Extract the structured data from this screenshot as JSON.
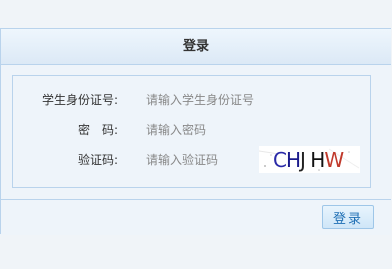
{
  "panel": {
    "title": "登录"
  },
  "form": {
    "student_id": {
      "label": "学生身份证号:",
      "placeholder": "请输入学生身份证号",
      "value": ""
    },
    "password": {
      "label": "密　码:",
      "placeholder": "请输入密码",
      "value": ""
    },
    "captcha": {
      "label": "验证码:",
      "placeholder": "请输入验证码",
      "value": ""
    }
  },
  "captcha_image": {
    "c1": "C",
    "c2": "H",
    "c3": "J",
    "c4": "H",
    "c5": "W"
  },
  "footer": {
    "login_label": "登录"
  },
  "colors": {
    "accent": "#1f6fb5",
    "border": "#b9d3ec",
    "background": "#eef4fa"
  }
}
